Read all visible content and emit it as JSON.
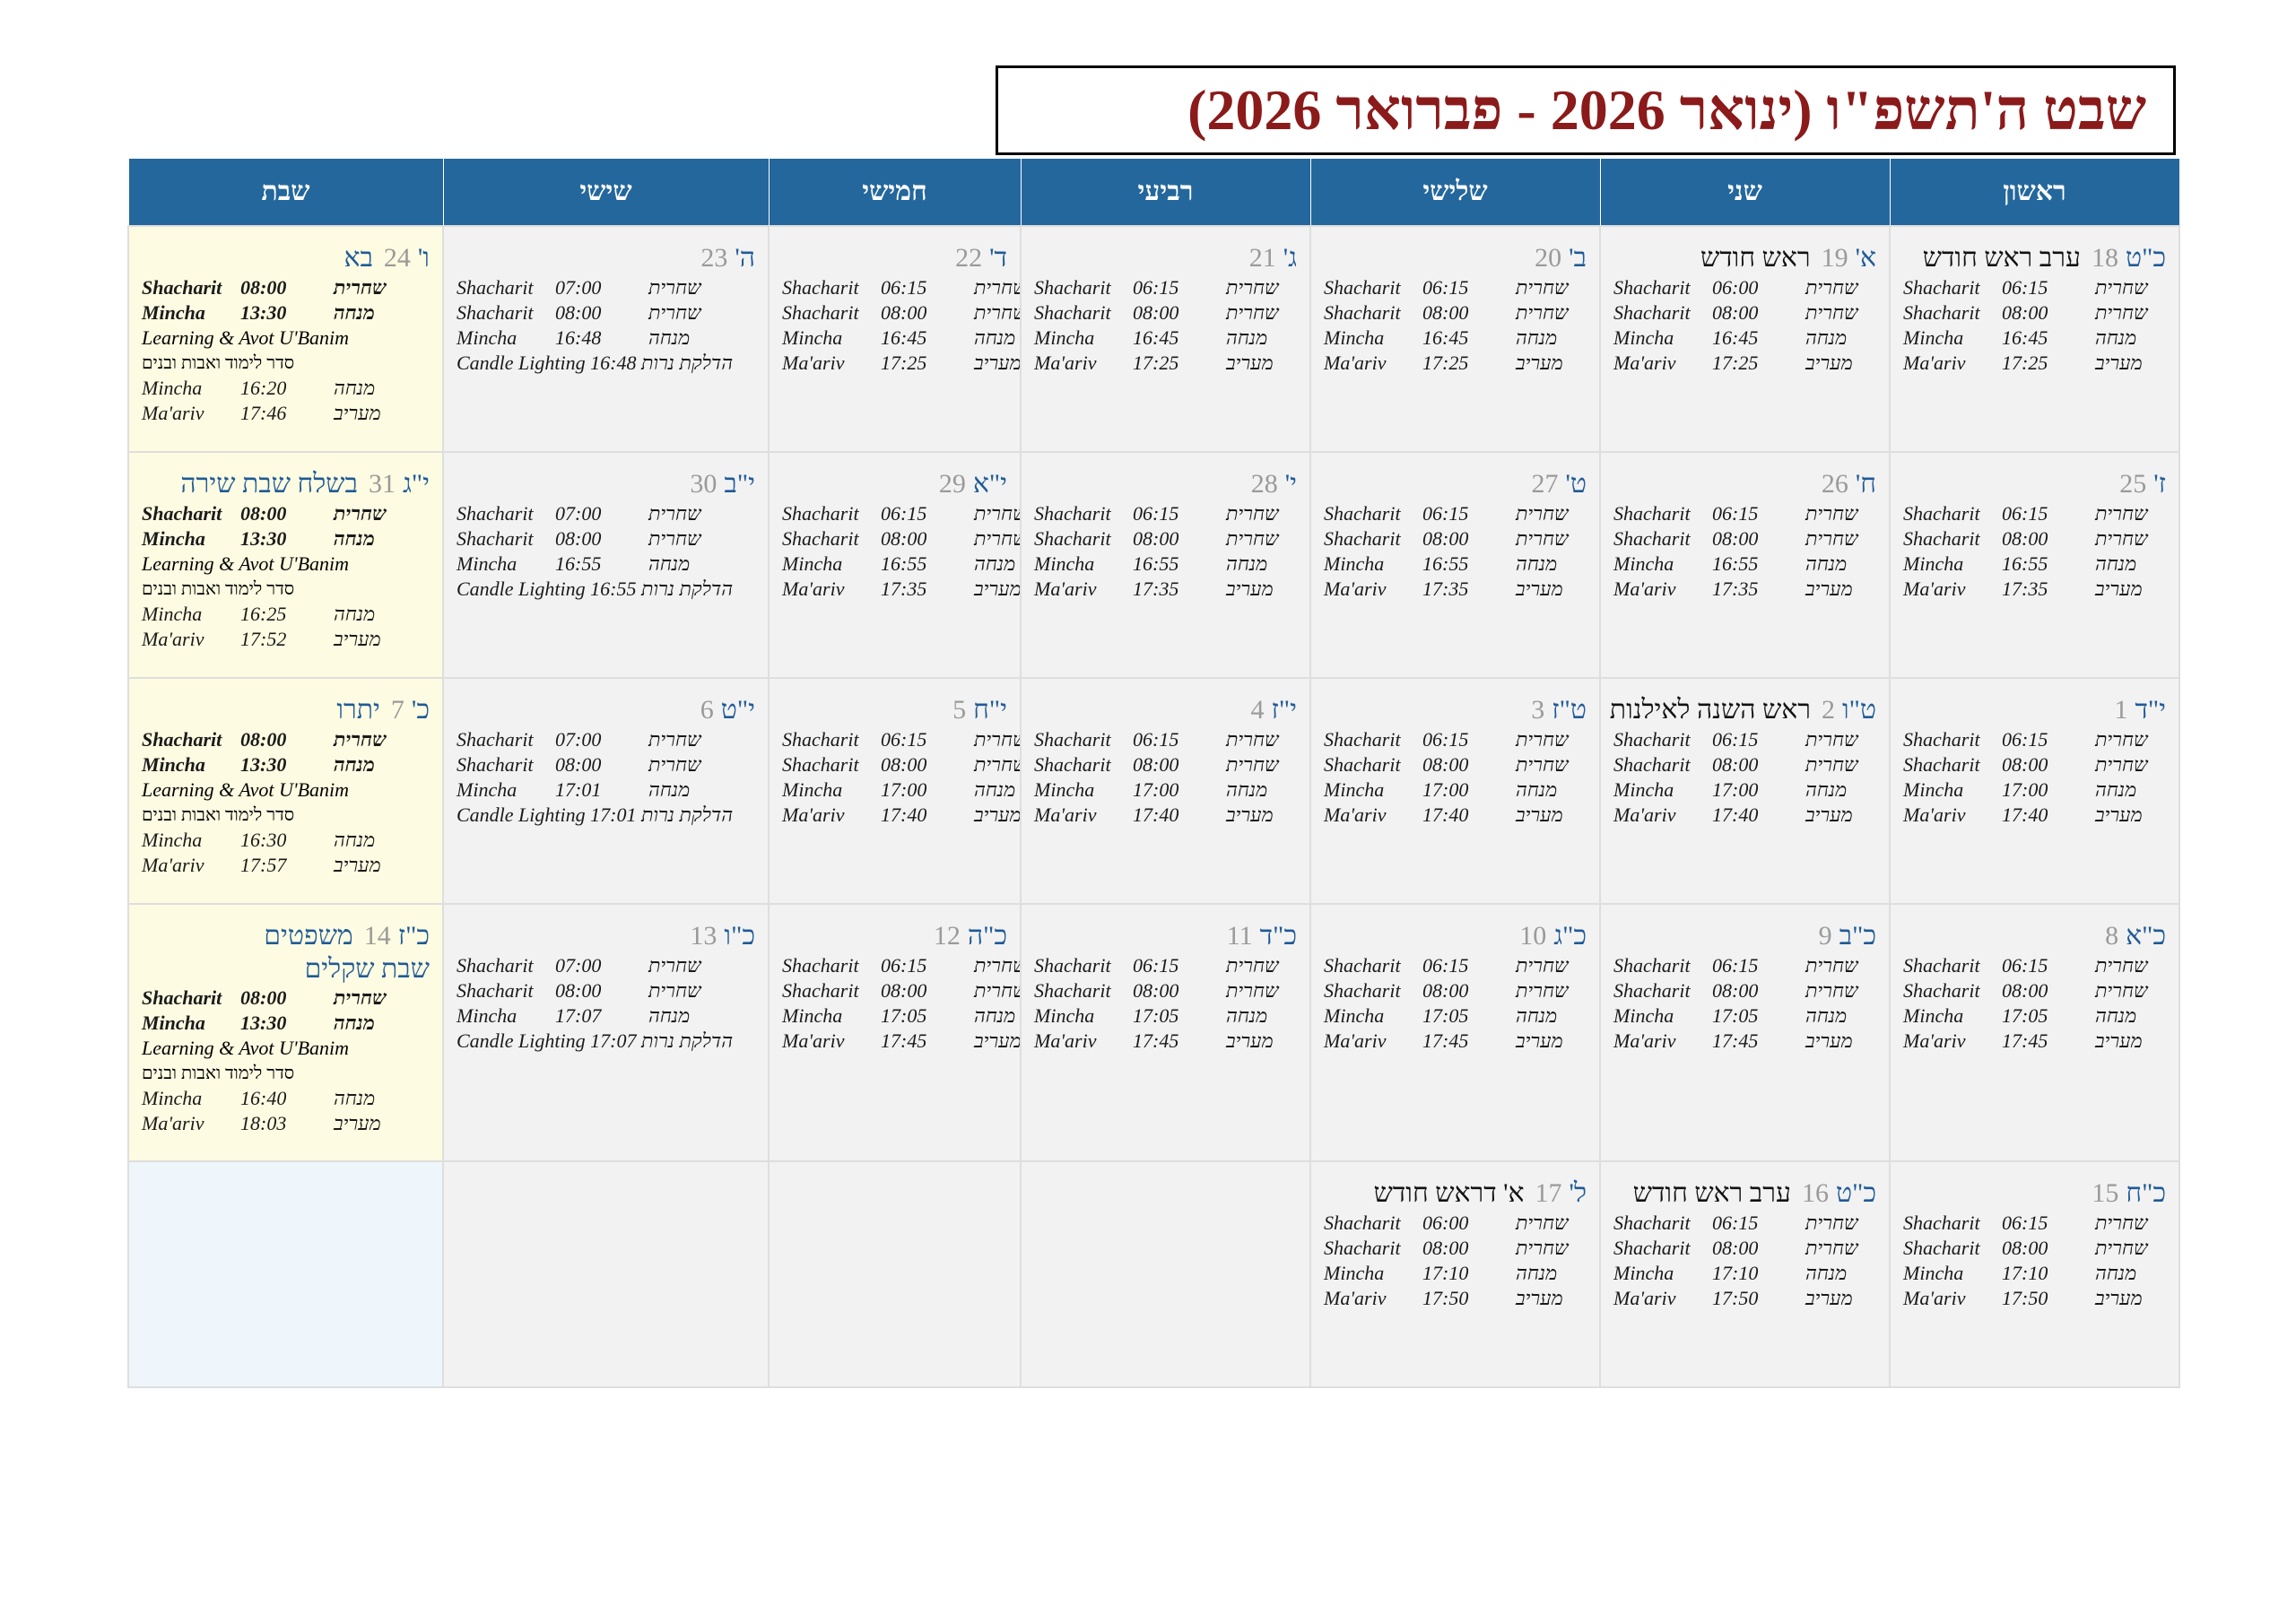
{
  "title": "שבט ה'תשפ\"ו (ינואר 2026 - פברואר 2026)",
  "days": [
    "ראשון",
    "שני",
    "שלישי",
    "רביעי",
    "חמישי",
    "שישי",
    "שבת"
  ],
  "labels": {
    "shacharit_en": "Shacharit",
    "mincha_en": "Mincha",
    "maariv_en": "Ma'ariv",
    "candle_en": "Candle Lighting",
    "learning_en": "Learning & Avot U'Banim",
    "shacharit_he": "שחרית",
    "mincha_he": "מנחה",
    "maariv_he": "מעריב",
    "candle_he": "הדלקת נרות",
    "learning_he": "סדר לימוד ואבות ובנים"
  },
  "weeks": [
    {
      "sun": {
        "hd": "כ\"ט",
        "gd": "18",
        "ev": "ערב ראש חודש",
        "sh1": "06:15",
        "sh2": "08:00",
        "mi": "16:45",
        "ma": "17:25"
      },
      "mon": {
        "hd": "א'",
        "gd": "19",
        "ev": "ראש חודש",
        "sh1": "06:00",
        "sh2": "08:00",
        "mi": "16:45",
        "ma": "17:25"
      },
      "tue": {
        "hd": "ב'",
        "gd": "20",
        "sh1": "06:15",
        "sh2": "08:00",
        "mi": "16:45",
        "ma": "17:25"
      },
      "wed": {
        "hd": "ג'",
        "gd": "21",
        "sh1": "06:15",
        "sh2": "08:00",
        "mi": "16:45",
        "ma": "17:25"
      },
      "thu": {
        "hd": "ד'",
        "gd": "22",
        "sh1": "06:15",
        "sh2": "08:00",
        "mi": "16:45",
        "ma": "17:25"
      },
      "fri": {
        "hd": "ה'",
        "gd": "23",
        "sh1": "07:00",
        "sh2": "08:00",
        "mi": "16:48",
        "cl": "16:48"
      },
      "sat": {
        "hd": "ו'",
        "gd": "24",
        "par": "בא",
        "sh": "08:00",
        "mi1": "13:30",
        "mi2": "16:20",
        "ma": "17:46"
      }
    },
    {
      "sun": {
        "hd": "ז'",
        "gd": "25",
        "sh1": "06:15",
        "sh2": "08:00",
        "mi": "16:55",
        "ma": "17:35"
      },
      "mon": {
        "hd": "ח'",
        "gd": "26",
        "sh1": "06:15",
        "sh2": "08:00",
        "mi": "16:55",
        "ma": "17:35"
      },
      "tue": {
        "hd": "ט'",
        "gd": "27",
        "sh1": "06:15",
        "sh2": "08:00",
        "mi": "16:55",
        "ma": "17:35"
      },
      "wed": {
        "hd": "י'",
        "gd": "28",
        "sh1": "06:15",
        "sh2": "08:00",
        "mi": "16:55",
        "ma": "17:35"
      },
      "thu": {
        "hd": "י\"א",
        "gd": "29",
        "sh1": "06:15",
        "sh2": "08:00",
        "mi": "16:55",
        "ma": "17:35"
      },
      "fri": {
        "hd": "י\"ב",
        "gd": "30",
        "sh1": "07:00",
        "sh2": "08:00",
        "mi": "16:55",
        "cl": "16:55"
      },
      "sat": {
        "hd": "י\"ג",
        "gd": "31",
        "par": "בשלח שבת שירה",
        "sh": "08:00",
        "mi1": "13:30",
        "mi2": "16:25",
        "ma": "17:52"
      }
    },
    {
      "sun": {
        "hd": "י\"ד",
        "gd": "1",
        "sh1": "06:15",
        "sh2": "08:00",
        "mi": "17:00",
        "ma": "17:40"
      },
      "mon": {
        "hd": "ט\"ו",
        "gd": "2",
        "ev": "ראש השנה לאילנות",
        "sh1": "06:15",
        "sh2": "08:00",
        "mi": "17:00",
        "ma": "17:40"
      },
      "tue": {
        "hd": "ט\"ז",
        "gd": "3",
        "sh1": "06:15",
        "sh2": "08:00",
        "mi": "17:00",
        "ma": "17:40"
      },
      "wed": {
        "hd": "י\"ז",
        "gd": "4",
        "sh1": "06:15",
        "sh2": "08:00",
        "mi": "17:00",
        "ma": "17:40"
      },
      "thu": {
        "hd": "י\"ח",
        "gd": "5",
        "sh1": "06:15",
        "sh2": "08:00",
        "mi": "17:00",
        "ma": "17:40"
      },
      "fri": {
        "hd": "י\"ט",
        "gd": "6",
        "sh1": "07:00",
        "sh2": "08:00",
        "mi": "17:01",
        "cl": "17:01"
      },
      "sat": {
        "hd": "כ'",
        "gd": "7",
        "par": "יתרו",
        "sh": "08:00",
        "mi1": "13:30",
        "mi2": "16:30",
        "ma": "17:57"
      }
    },
    {
      "sun": {
        "hd": "כ\"א",
        "gd": "8",
        "sh1": "06:15",
        "sh2": "08:00",
        "mi": "17:05",
        "ma": "17:45"
      },
      "mon": {
        "hd": "כ\"ב",
        "gd": "9",
        "sh1": "06:15",
        "sh2": "08:00",
        "mi": "17:05",
        "ma": "17:45"
      },
      "tue": {
        "hd": "כ\"ג",
        "gd": "10",
        "sh1": "06:15",
        "sh2": "08:00",
        "mi": "17:05",
        "ma": "17:45"
      },
      "wed": {
        "hd": "כ\"ד",
        "gd": "11",
        "sh1": "06:15",
        "sh2": "08:00",
        "mi": "17:05",
        "ma": "17:45"
      },
      "thu": {
        "hd": "כ\"ה",
        "gd": "12",
        "sh1": "06:15",
        "sh2": "08:00",
        "mi": "17:05",
        "ma": "17:45"
      },
      "fri": {
        "hd": "כ\"ו",
        "gd": "13",
        "sh1": "07:00",
        "sh2": "08:00",
        "mi": "17:07",
        "cl": "17:07"
      },
      "sat": {
        "hd": "כ\"ז",
        "gd": "14",
        "par": "משפטים",
        "par2": "שבת שקלים",
        "sh": "08:00",
        "mi1": "13:30",
        "mi2": "16:40",
        "ma": "18:03"
      }
    },
    {
      "sun": {
        "hd": "כ\"ח",
        "gd": "15",
        "sh1": "06:15",
        "sh2": "08:00",
        "mi": "17:10",
        "ma": "17:50"
      },
      "mon": {
        "hd": "כ\"ט",
        "gd": "16",
        "ev": "ערב ראש חודש",
        "sh1": "06:15",
        "sh2": "08:00",
        "mi": "17:10",
        "ma": "17:50"
      },
      "tue": {
        "hd": "ל'",
        "gd": "17",
        "ev": "א' דראש חודש",
        "sh1": "06:00",
        "sh2": "08:00",
        "mi": "17:10",
        "ma": "17:50"
      }
    }
  ]
}
